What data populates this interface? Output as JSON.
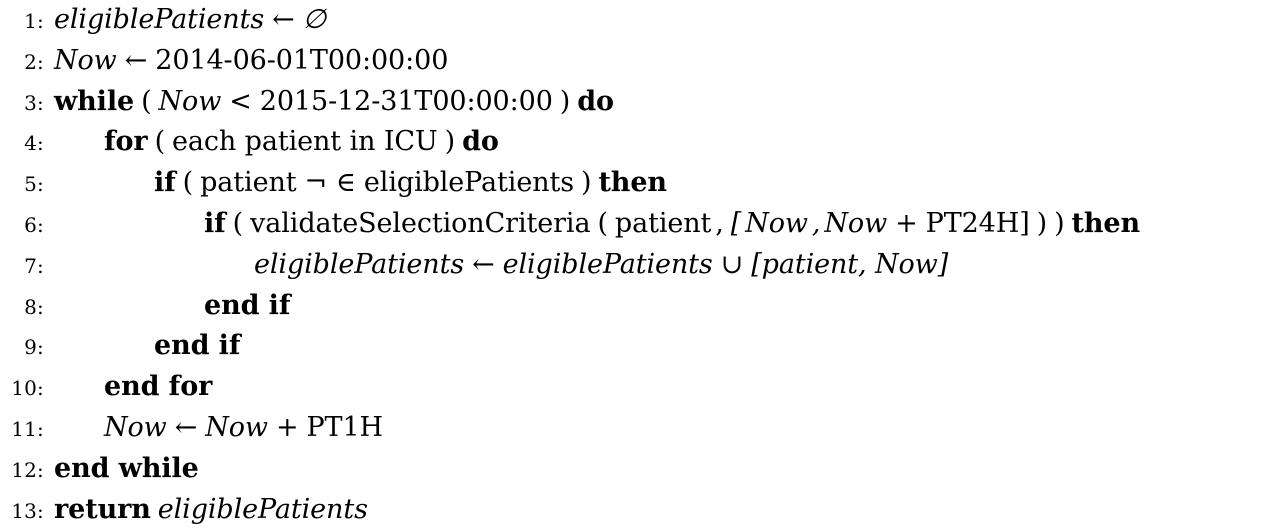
{
  "algorithm": {
    "font_color": "#000000",
    "background_color": "#ffffff",
    "lines": [
      {
        "number": "1:",
        "indent": 0,
        "text": "eligiblePatients ← ∅",
        "tokens": [
          {
            "t": "eligiblePatients",
            "s": "var"
          },
          {
            "t": "←",
            "s": "op"
          },
          {
            "t": "∅",
            "s": "var"
          }
        ]
      },
      {
        "number": "2:",
        "indent": 0,
        "text": "Now ← 2014-06-01T00:00:00",
        "tokens": [
          {
            "t": "Now",
            "s": "var"
          },
          {
            "t": "←",
            "s": "op"
          },
          {
            "t": "2014-06-01T00:00:00",
            "s": "rm"
          }
        ]
      },
      {
        "number": "3:",
        "indent": 0,
        "text": "while ( Now < 2015-12-31T00:00:00 ) do",
        "tokens": [
          {
            "t": "while",
            "s": "kw"
          },
          {
            "t": "(",
            "s": "paren"
          },
          {
            "t": "Now",
            "s": "var"
          },
          {
            "t": "<",
            "s": "op"
          },
          {
            "t": "2015-12-31T00:00:00",
            "s": "rm"
          },
          {
            "t": ")",
            "s": "paren"
          },
          {
            "t": "do",
            "s": "kw"
          }
        ]
      },
      {
        "number": "4:",
        "indent": 1,
        "text": "for ( each patient in ICU ) do",
        "tokens": [
          {
            "t": "for",
            "s": "kw"
          },
          {
            "t": "(",
            "s": "paren"
          },
          {
            "t": "each patient in ICU",
            "s": "rm"
          },
          {
            "t": ")",
            "s": "paren"
          },
          {
            "t": "do",
            "s": "kw"
          }
        ]
      },
      {
        "number": "5:",
        "indent": 2,
        "text": "if ( patient ¬ ∈ eligiblePatients ) then",
        "tokens": [
          {
            "t": "if",
            "s": "kw"
          },
          {
            "t": "(",
            "s": "paren"
          },
          {
            "t": "patient",
            "s": "rm"
          },
          {
            "t": "¬",
            "s": "op"
          },
          {
            "t": "∈",
            "s": "op"
          },
          {
            "t": "eligiblePatients",
            "s": "rm"
          },
          {
            "t": ")",
            "s": "paren"
          },
          {
            "t": "then",
            "s": "kw"
          }
        ]
      },
      {
        "number": "6:",
        "indent": 3,
        "text": "if ( validateSelectionCriteria ( patient , [Now, Now+PT24H] ) ) then",
        "tokens": [
          {
            "t": "if",
            "s": "kw"
          },
          {
            "t": "(",
            "s": "paren"
          },
          {
            "t": "validateSelectionCriteria",
            "s": "rm"
          },
          {
            "t": "(",
            "s": "paren"
          },
          {
            "t": "patient",
            "s": "rm"
          },
          {
            "t": ",",
            "s": "rm"
          },
          {
            "t": "[",
            "s": "var"
          },
          {
            "t": "Now",
            "s": "var"
          },
          {
            "t": ",",
            "s": "var"
          },
          {
            "t": "Now",
            "s": "var"
          },
          {
            "t": "+",
            "s": "op"
          },
          {
            "t": "PT24H]",
            "s": "rm"
          },
          {
            "t": ")",
            "s": "paren"
          },
          {
            "t": ")",
            "s": "paren"
          },
          {
            "t": "then",
            "s": "kw"
          }
        ]
      },
      {
        "number": "7:",
        "indent": 4,
        "text": "eligiblePatients ← eligiblePatients ∪ [patient, Now]",
        "tokens": [
          {
            "t": "eligiblePatients",
            "s": "var"
          },
          {
            "t": "←",
            "s": "op"
          },
          {
            "t": "eligiblePatients",
            "s": "var"
          },
          {
            "t": "∪",
            "s": "op"
          },
          {
            "t": "[patient, Now]",
            "s": "var"
          }
        ]
      },
      {
        "number": "8:",
        "indent": 3,
        "text": "end if",
        "tokens": [
          {
            "t": "end if",
            "s": "kw"
          }
        ]
      },
      {
        "number": "9:",
        "indent": 2,
        "text": "end if",
        "tokens": [
          {
            "t": "end if",
            "s": "kw"
          }
        ]
      },
      {
        "number": "10:",
        "indent": 1,
        "text": "end for",
        "tokens": [
          {
            "t": "end for",
            "s": "kw"
          }
        ]
      },
      {
        "number": "11:",
        "indent": 1,
        "text": "Now ← Now+ PT1H",
        "tokens": [
          {
            "t": "Now",
            "s": "var"
          },
          {
            "t": "←",
            "s": "op"
          },
          {
            "t": "Now",
            "s": "var"
          },
          {
            "t": "+",
            "s": "op"
          },
          {
            "t": "PT1H",
            "s": "rm"
          }
        ]
      },
      {
        "number": "12:",
        "indent": 0,
        "text": "end while",
        "tokens": [
          {
            "t": "end while",
            "s": "kw"
          }
        ]
      },
      {
        "number": "13:",
        "indent": 0,
        "text": "return eligiblePatients",
        "tokens": [
          {
            "t": "return",
            "s": "kw"
          },
          {
            "t": "eligiblePatients",
            "s": "var"
          }
        ]
      }
    ]
  }
}
